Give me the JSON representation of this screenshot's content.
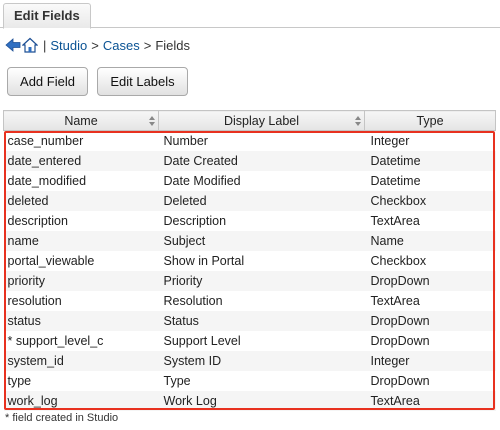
{
  "tab": {
    "label": "Edit Fields"
  },
  "breadcrumb": {
    "studio": "Studio",
    "cases": "Cases",
    "fields": "Fields",
    "sep_bar": "|",
    "sep_arrow": ">",
    "back_icon": "back-arrow-icon",
    "home_icon": "home-icon"
  },
  "toolbar": {
    "add_field": "Add Field",
    "edit_labels": "Edit Labels"
  },
  "table": {
    "headers": [
      "Name",
      "Display Label",
      "Type"
    ],
    "rows": [
      [
        "case_number",
        "Number",
        "Integer"
      ],
      [
        "date_entered",
        "Date Created",
        "Datetime"
      ],
      [
        "date_modified",
        "Date Modified",
        "Datetime"
      ],
      [
        "deleted",
        "Deleted",
        "Checkbox"
      ],
      [
        "description",
        "Description",
        "TextArea"
      ],
      [
        "name",
        "Subject",
        "Name"
      ],
      [
        "portal_viewable",
        "Show in Portal",
        "Checkbox"
      ],
      [
        "priority",
        "Priority",
        "DropDown"
      ],
      [
        "resolution",
        "Resolution",
        "TextArea"
      ],
      [
        "status",
        "Status",
        "DropDown"
      ],
      [
        "* support_level_c",
        "Support Level",
        "DropDown"
      ],
      [
        "system_id",
        "System ID",
        "Integer"
      ],
      [
        "type",
        "Type",
        "DropDown"
      ],
      [
        "work_log",
        "Work Log",
        "TextArea"
      ]
    ]
  },
  "footnote": "* field created in Studio",
  "colors": {
    "highlight": "#e8311f",
    "link": "#0b5394"
  }
}
